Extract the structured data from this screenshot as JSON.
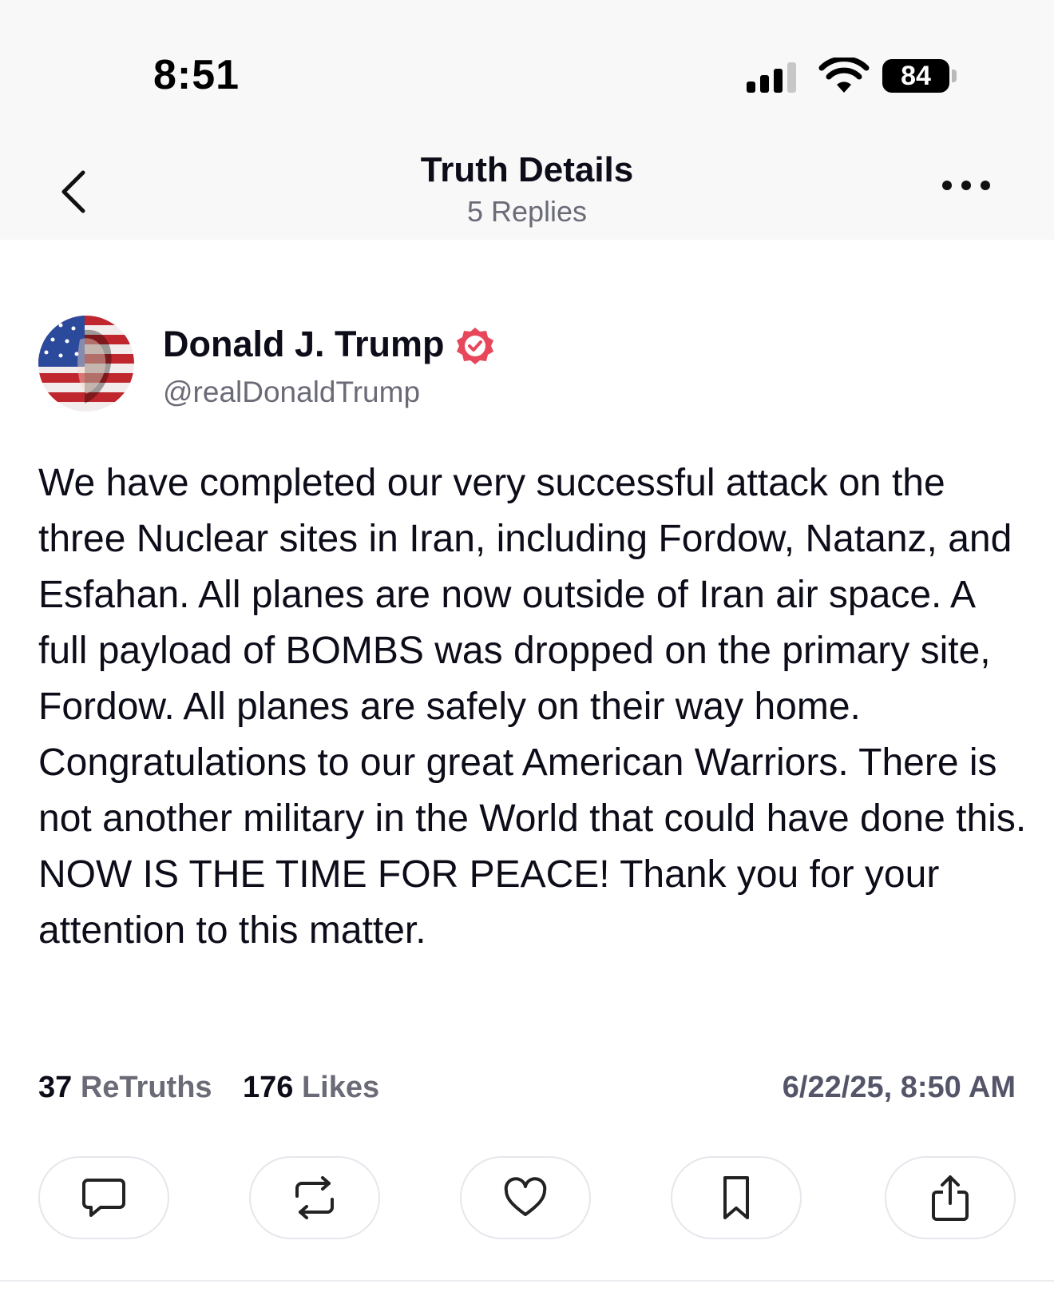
{
  "status_bar": {
    "time": "8:51",
    "battery_level": "84",
    "icons": [
      "signal-bars-icon",
      "wifi-icon",
      "battery-icon"
    ]
  },
  "nav": {
    "title": "Truth Details",
    "subtitle": "5 Replies",
    "icons": [
      "chevron-left-icon",
      "more-horizontal-icon"
    ]
  },
  "post": {
    "author_name": "Donald J. Trump",
    "author_handle": "@realDonaldTrump",
    "verified": true,
    "body": "We have completed our very successful attack on the three Nuclear sites in Iran, including Fordow, Natanz, and Esfahan. All planes are now outside of Iran air space. A full payload of BOMBS was dropped on the primary site, Fordow. All planes are safely on their way home. Congratulations to our great American Warriors. There is not another military in the World that could have done this. NOW IS THE TIME FOR PEACE! Thank you for your attention to this matter.",
    "retruths_count": "37",
    "retruths_label": "ReTruths",
    "likes_count": "176",
    "likes_label": "Likes",
    "timestamp": "6/22/25, 8:50 AM"
  },
  "actions": [
    "reply-icon",
    "retruth-icon",
    "heart-icon",
    "bookmark-icon",
    "share-icon"
  ],
  "colors": {
    "verified": "#e8475b",
    "text_primary": "#0d0d1a",
    "text_secondary": "#6b6b78",
    "header_bg": "#f8f8f8",
    "button_border": "#e6e6ec"
  }
}
